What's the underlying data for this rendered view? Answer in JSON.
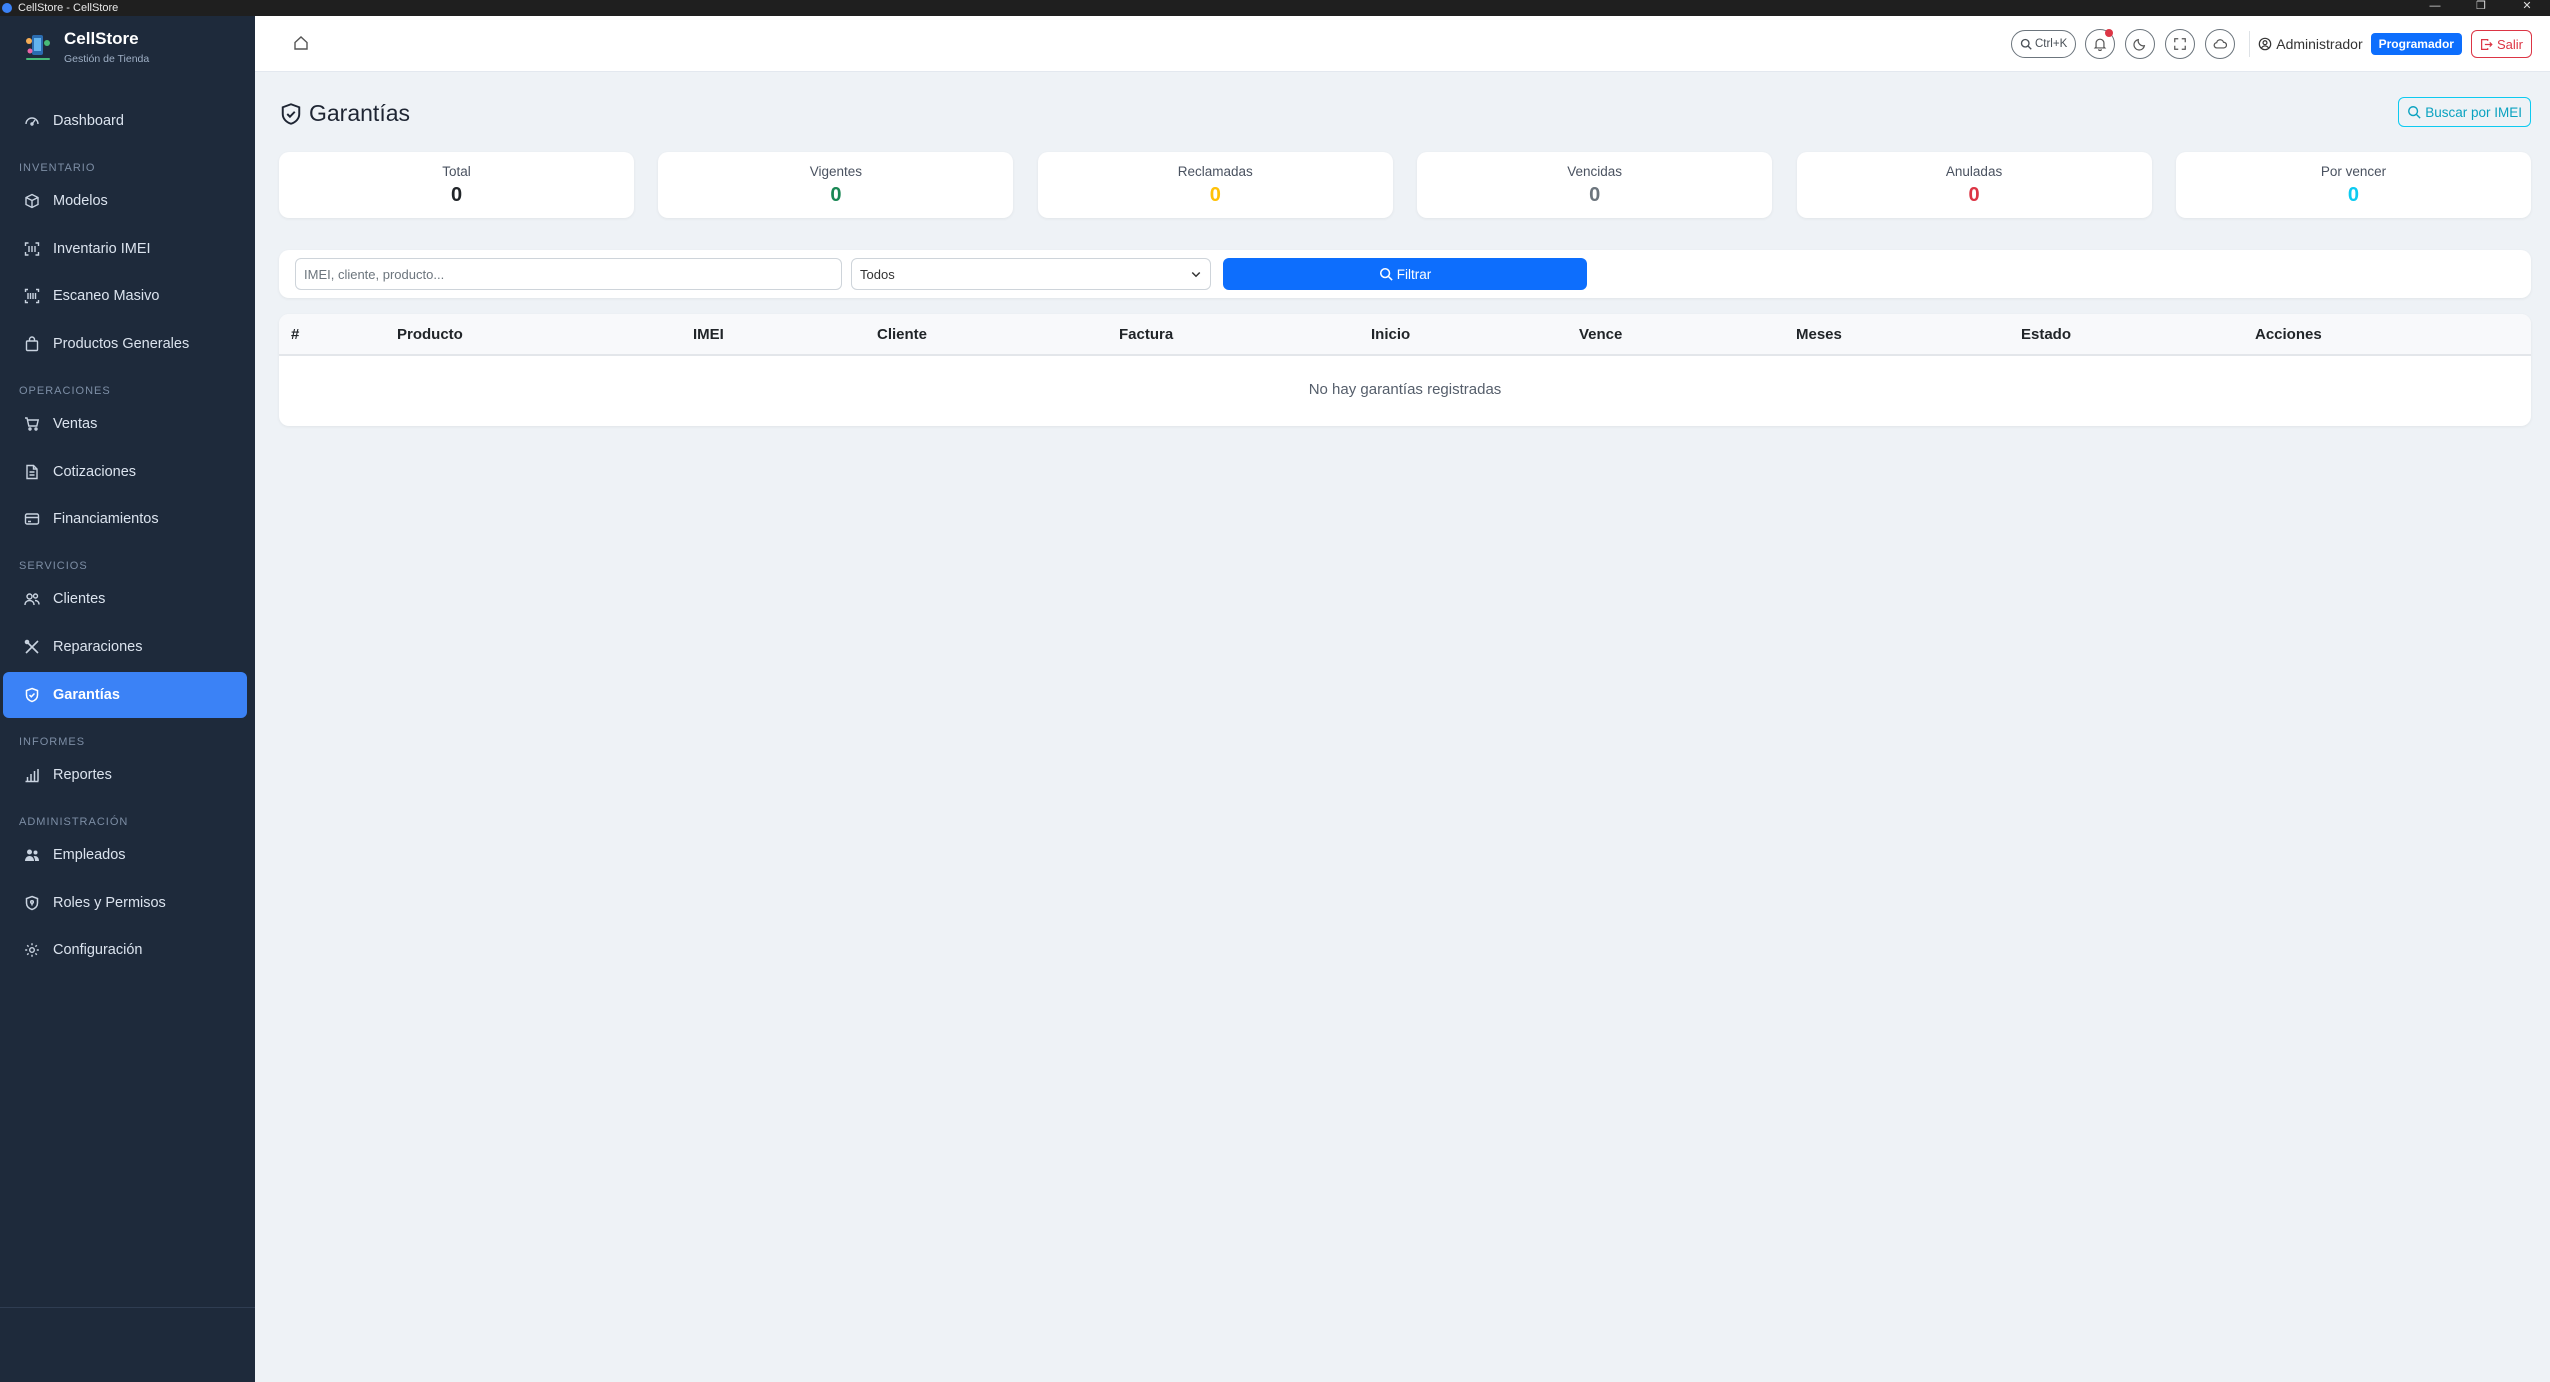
{
  "window": {
    "title": "CellStore - CellStore",
    "controls": [
      "—",
      "❐",
      "✕"
    ]
  },
  "brand": {
    "name": "CellStore",
    "subtitle": "Gestión de Tienda"
  },
  "sidebar": {
    "dashboard": "Dashboard",
    "sections": {
      "inventario": "INVENTARIO",
      "operaciones": "OPERACIONES",
      "servicios": "SERVICIOS",
      "informes": "INFORMES",
      "administracion": "ADMINISTRACIÓN"
    },
    "items": {
      "modelos": "Modelos",
      "inventario_imei": "Inventario IMEI",
      "escaneo_masivo": "Escaneo Masivo",
      "productos_generales": "Productos Generales",
      "ventas": "Ventas",
      "cotizaciones": "Cotizaciones",
      "financiamientos": "Financiamientos",
      "clientes": "Clientes",
      "reparaciones": "Reparaciones",
      "garantias": "Garantías",
      "reportes": "Reportes",
      "empleados": "Empleados",
      "roles": "Roles y Permisos",
      "configuracion": "Configuración"
    },
    "active": "garantias"
  },
  "topbar": {
    "search_shortcut": "Ctrl+K",
    "user_name": "Administrador",
    "role_badge": "Programador",
    "logout_label": "Salir"
  },
  "page": {
    "title": "Garantías",
    "imei_search_label": "Buscar por IMEI"
  },
  "stats": [
    {
      "label": "Total",
      "value": "0",
      "color": "#212529"
    },
    {
      "label": "Vigentes",
      "value": "0",
      "color": "#198754"
    },
    {
      "label": "Reclamadas",
      "value": "0",
      "color": "#ffc107"
    },
    {
      "label": "Vencidas",
      "value": "0",
      "color": "#6c757d"
    },
    {
      "label": "Anuladas",
      "value": "0",
      "color": "#dc3545"
    },
    {
      "label": "Por vencer",
      "value": "0",
      "color": "#0dcaf0"
    }
  ],
  "filters": {
    "search_placeholder": "IMEI, cliente, producto...",
    "status_selected": "Todos",
    "filter_button": "Filtrar"
  },
  "table": {
    "columns": [
      "#",
      "Producto",
      "IMEI",
      "Cliente",
      "Factura",
      "Inicio",
      "Vence",
      "Meses",
      "Estado",
      "Acciones"
    ],
    "empty_message": "No hay garantías registradas"
  },
  "colors": {
    "sidebar_bg": "#1e2a3b",
    "accent": "#3b82f6",
    "primary": "#0d6efd",
    "danger": "#dc3545",
    "info": "#0dcaf0"
  }
}
